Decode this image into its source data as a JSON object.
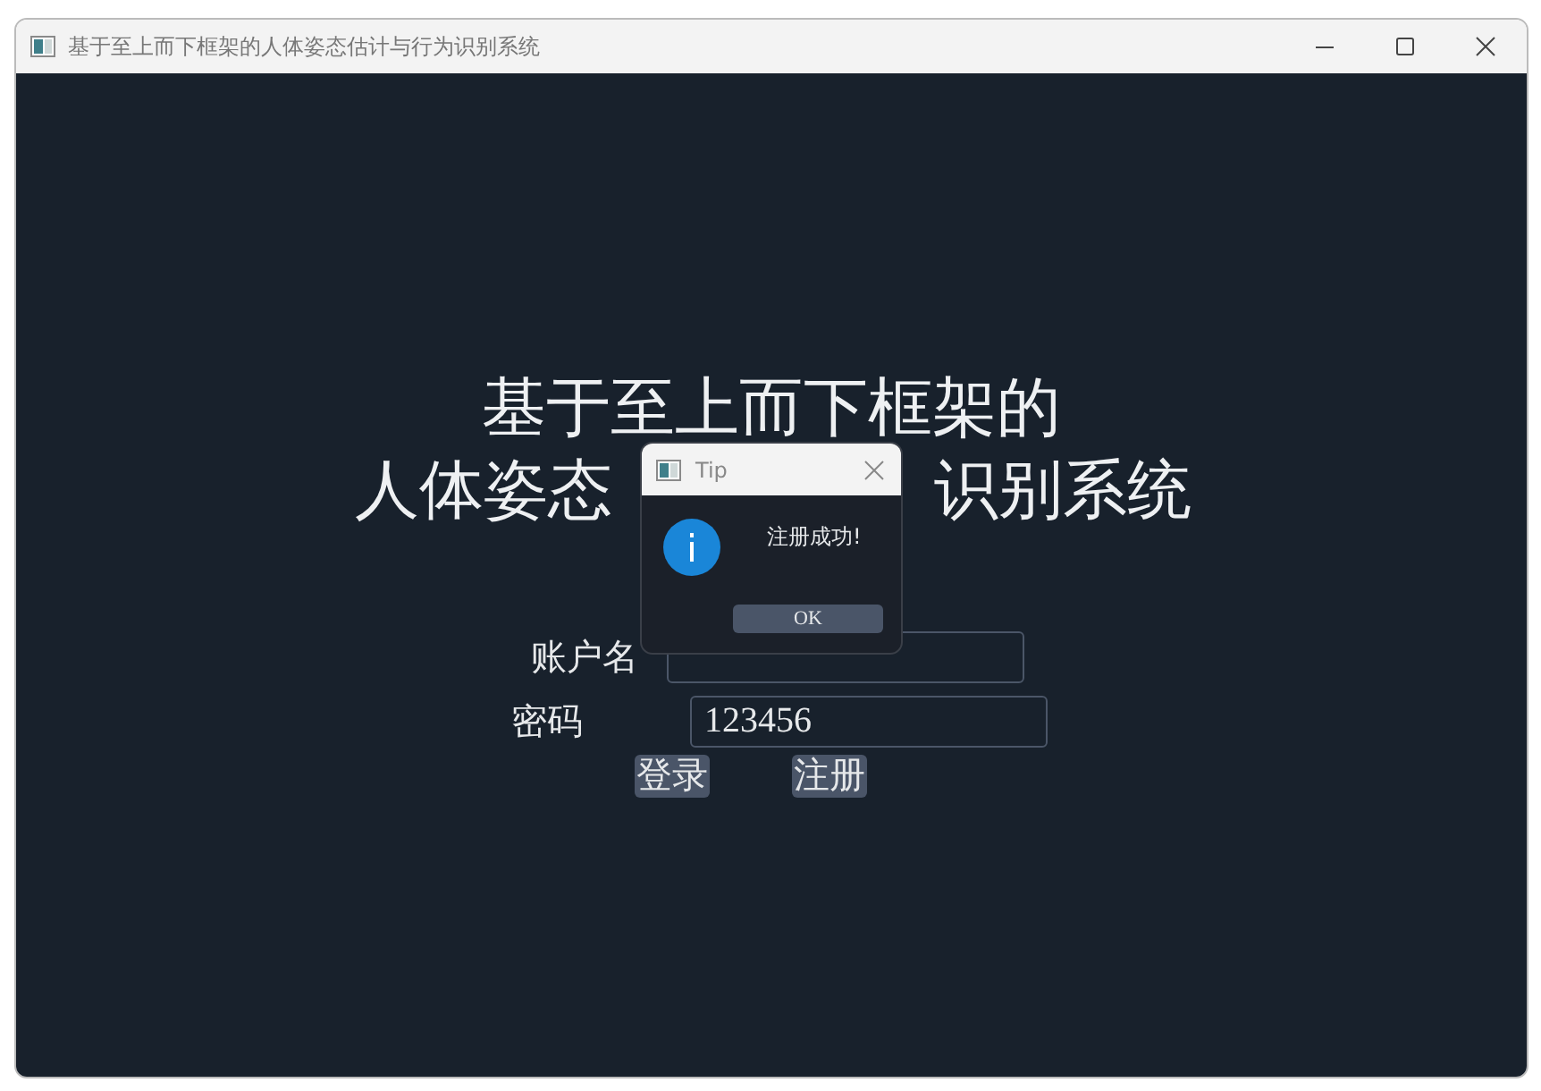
{
  "window": {
    "title": "基于至上而下框架的人体姿态估计与行为识别系统"
  },
  "heading": {
    "line_1": "基于至上而下框架的",
    "line_2_left": "人体姿态",
    "line_2_right": "识别系统"
  },
  "fields": [
    {
      "label": "账户名"
    },
    {
      "label": "密码",
      "value": "123456"
    }
  ],
  "buttons": [
    "登录",
    "注册"
  ],
  "dialog": {
    "title": "Tip",
    "message": "注册成功!",
    "button": "OK"
  }
}
